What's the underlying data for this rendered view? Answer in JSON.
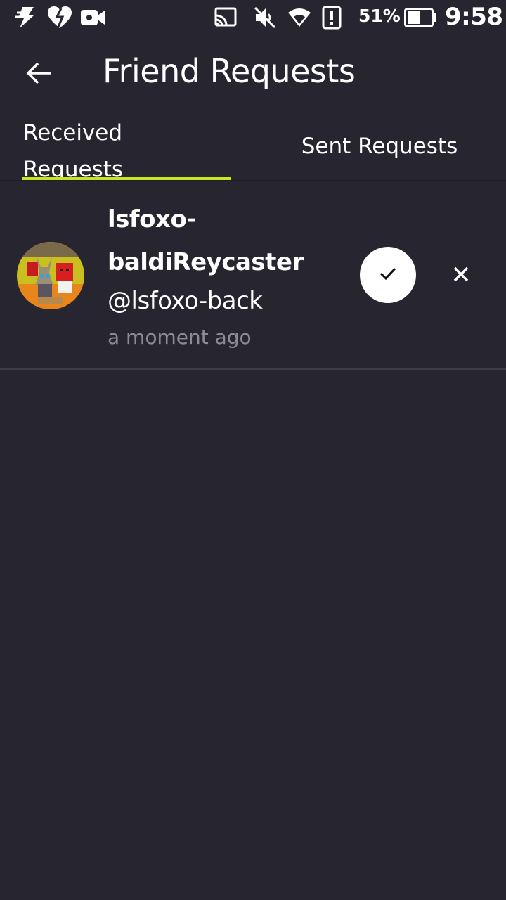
{
  "status_bar": {
    "battery_percent": "51%",
    "time": "9:58",
    "icons": [
      "flash-icon",
      "heart-icon",
      "video-camera-icon",
      "cast-icon",
      "mute-icon",
      "wifi-icon",
      "alert-icon",
      "battery-icon"
    ]
  },
  "app_bar": {
    "title": "Friend Requests",
    "back_icon": "arrow-left-icon"
  },
  "tabs": [
    {
      "label": "Received Requests",
      "selected": true
    },
    {
      "label": "Sent Requests",
      "selected": false
    }
  ],
  "colors": {
    "background": "#272530",
    "accent": "#c8e61e",
    "secondary_text": "#8d8b94"
  },
  "requests": [
    {
      "name": "lsfoxo-baldiReycaster",
      "handle": "@lsfoxo-back",
      "time": "a moment ago",
      "accept_icon": "check-icon",
      "decline_icon": "close-icon"
    }
  ]
}
